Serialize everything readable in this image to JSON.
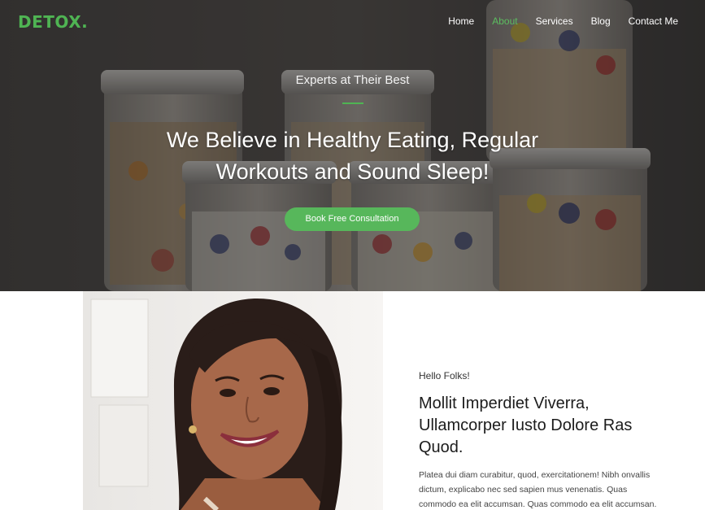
{
  "brand": {
    "logo_text": "DETOX.",
    "accent_color": "#4fb453"
  },
  "nav": {
    "items": [
      {
        "label": "Home",
        "active": false
      },
      {
        "label": "About",
        "active": true
      },
      {
        "label": "Services",
        "active": false
      },
      {
        "label": "Blog",
        "active": false
      },
      {
        "label": "Contact Me",
        "active": false
      }
    ]
  },
  "hero": {
    "subtitle": "Experts at Their Best",
    "title_line1": "We Believe in Healthy Eating, Regular",
    "title_line2": "Workouts and Sound Sleep!",
    "cta_label": "Book Free Consultation"
  },
  "about": {
    "greeting": "Hello Folks!",
    "heading": "Mollit Imperdiet Viverra, Ullamcorper Iusto Dolore Ras Quod.",
    "body": "Platea dui diam curabitur, quod, exercitationem! Nibh onvallis dictum, explicabo nec sed sapien mus venenatis. Quas commodo ea elit accumsan. Quas commodo ea elit accumsan."
  }
}
